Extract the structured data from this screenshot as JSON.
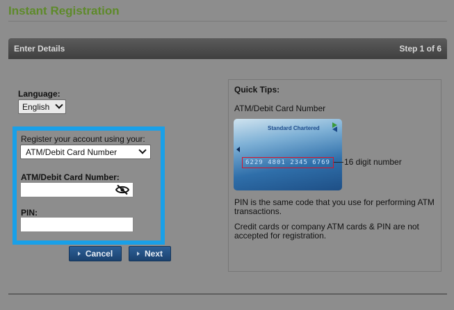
{
  "page": {
    "title": "Instant Registration"
  },
  "panel": {
    "title": "Enter Details",
    "step": "Step 1 of 6"
  },
  "language": {
    "label": "Language:",
    "selected": "English"
  },
  "registration": {
    "method_label": "Register your account using your:",
    "method_selected": "ATM/Debit Card Number",
    "card_label": "ATM/Debit Card Number:",
    "card_value": "",
    "pin_label": "PIN:",
    "pin_value": ""
  },
  "buttons": {
    "cancel": "Cancel",
    "next": "Next"
  },
  "tips": {
    "title": "Quick Tips:",
    "subtitle": "ATM/Debit Card Number",
    "card_brand": "Standard Chartered",
    "card_number": "6229 4801 2345 6769",
    "card_number_caption": "16 digit number",
    "pin_note": "PIN is the same code that you use for performing ATM transactions.",
    "credit_note": "Credit cards or company ATM cards & PIN are not accepted for registration."
  },
  "icons": {
    "password_toggle": "eye-slash-icon",
    "select_arrow": "chevron-down-icon",
    "button_arrow": "triangle-right-icon"
  },
  "colors": {
    "title_green": "#5e8a2a",
    "highlight_blue": "#19a0e8",
    "button_blue": "#1b426f",
    "card_number_red": "#d8142a"
  }
}
